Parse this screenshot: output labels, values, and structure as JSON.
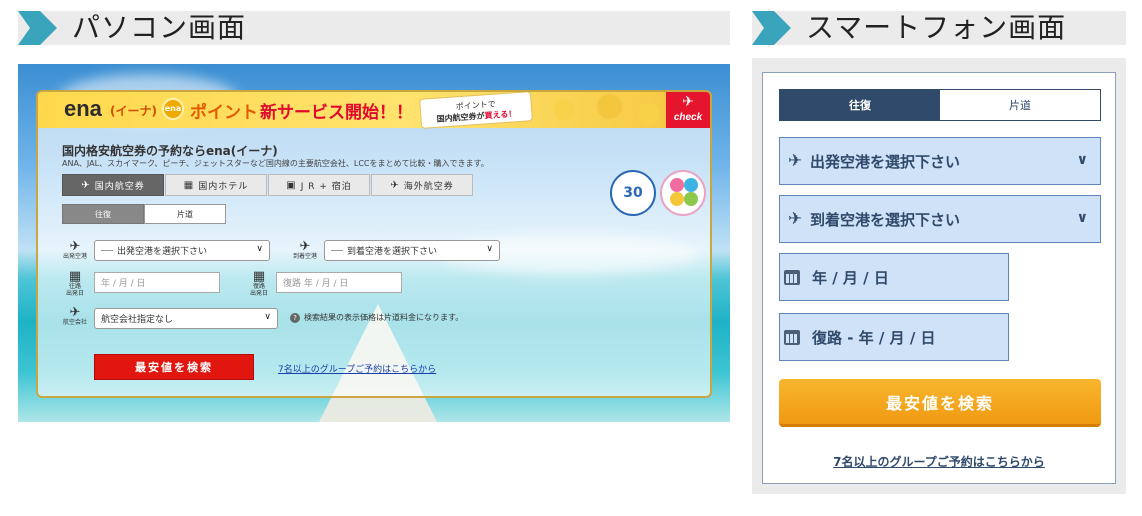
{
  "headers": {
    "pc_title": "パソコン画面",
    "sp_title": "スマートフォン画面"
  },
  "colors": {
    "header_arrow": "#3aa4bc",
    "header_bg": "#ebebeb",
    "pc_search_button": "#e0160f",
    "sp_search_button": "#f09a12",
    "sp_navy": "#2f4a6b",
    "sp_field_bg": "#cfe2f7"
  },
  "pc": {
    "banner": {
      "logo": "ena",
      "logo_sub": "(イーナ)",
      "coin_label": "ena",
      "point_text": "ポイント",
      "new_service_text": "新サービス開始！！",
      "callout_line1": "ポイントで",
      "callout_line2_prefix": "国内航空券が",
      "callout_line2_emph": "買える！",
      "check_label": "check",
      "check_icon": "plane-icon"
    },
    "heading": "国内格安航空券の予約ならena(イーナ)",
    "subheading": "ANA、JAL、スカイマーク、ピーチ、ジェットスターなど国内線の主要航空会社、LCCをまとめて比較・購入できます。",
    "tabs": [
      {
        "label": "国内航空券",
        "icon": "plane-icon"
      },
      {
        "label": "国内ホテル",
        "icon": "hotel-icon"
      },
      {
        "label": "J R + 宿泊",
        "icon": "train-icon"
      },
      {
        "label": "海外航空券",
        "icon": "plane-icon"
      }
    ],
    "trip_types": [
      "往復",
      "片道"
    ],
    "departure_label": "出発空港",
    "departure_placeholder": "出発空港を選択下さい",
    "arrival_label": "到着空港",
    "arrival_placeholder": "到着空港を選択下さい",
    "outbound_label_line1": "往路",
    "outbound_label_line2": "出発日",
    "outbound_placeholder": "年 / 月 / 日",
    "return_label_line1": "復路",
    "return_label_line2": "出発日",
    "return_placeholder": "復路 年 / 月 / 日",
    "airline_label": "航空会社",
    "airline_value": "航空会社指定なし",
    "note": "検索結果の表示価格は片道料金になります。",
    "search_button": "最安値を検索",
    "group_link": "7名以上のグループご予約はこちらから",
    "badge_30": "30"
  },
  "sp": {
    "trip_types": [
      "往復",
      "片道"
    ],
    "departure_placeholder": "出発空港を選択下さい",
    "arrival_placeholder": "到着空港を選択下さい",
    "outbound_placeholder": "年 / 月 / 日",
    "return_placeholder": "復路 - 年 / 月 / 日",
    "search_button": "最安値を検索",
    "group_link": "7名以上のグループご予約はこちらから"
  }
}
